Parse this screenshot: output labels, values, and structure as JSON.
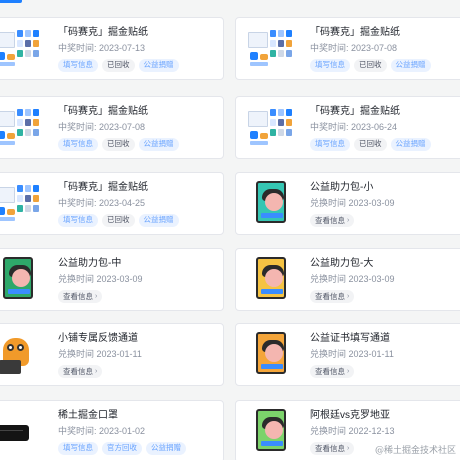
{
  "tab": {
    "active_indicator_color": "#1e80ff"
  },
  "cards": [
    {
      "title": "「码赛克」掘金贴纸",
      "time": "中奖时间: 2023-07-13",
      "thumb": "stickers",
      "buttons": [
        {
          "label": "填写信息",
          "style": "blue"
        },
        {
          "label": "已回收",
          "style": "gray"
        },
        {
          "label": "公益捐赠",
          "style": "blue"
        }
      ]
    },
    {
      "title": "「码赛克」掘金贴纸",
      "time": "中奖时间: 2023-07-08",
      "thumb": "stickers",
      "buttons": [
        {
          "label": "填写信息",
          "style": "blue"
        },
        {
          "label": "已回收",
          "style": "gray"
        },
        {
          "label": "公益捐赠",
          "style": "blue"
        }
      ]
    },
    {
      "title": "「码赛克」掘金贴纸",
      "time": "中奖时间: 2023-07-08",
      "thumb": "stickers",
      "buttons": [
        {
          "label": "填写信息",
          "style": "blue"
        },
        {
          "label": "已回收",
          "style": "gray"
        },
        {
          "label": "公益捐赠",
          "style": "blue"
        }
      ]
    },
    {
      "title": "「码赛克」掘金贴纸",
      "time": "中奖时间: 2023-06-24",
      "thumb": "stickers",
      "buttons": [
        {
          "label": "填写信息",
          "style": "blue"
        },
        {
          "label": "已回收",
          "style": "gray"
        },
        {
          "label": "公益捐赠",
          "style": "blue"
        }
      ]
    },
    {
      "title": "「码赛克」掘金贴纸",
      "time": "中奖时间: 2023-04-25",
      "thumb": "stickers",
      "buttons": [
        {
          "label": "填写信息",
          "style": "blue"
        },
        {
          "label": "已回收",
          "style": "gray"
        },
        {
          "label": "公益捐赠",
          "style": "blue"
        }
      ]
    },
    {
      "title": "公益助力包-小",
      "time": "兑换时间 2023-03-09",
      "thumb": "pack-teal",
      "buttons": [
        {
          "label": "查看信息",
          "style": "view"
        }
      ]
    },
    {
      "title": "公益助力包-中",
      "time": "兑换时间 2023-03-09",
      "thumb": "pack-green",
      "buttons": [
        {
          "label": "查看信息",
          "style": "view"
        }
      ]
    },
    {
      "title": "公益助力包-大",
      "time": "兑换时间 2023-03-09",
      "thumb": "pack-yellow",
      "buttons": [
        {
          "label": "查看信息",
          "style": "view"
        }
      ]
    },
    {
      "title": "小铺专属反馈通道",
      "time": "兑换时间 2023-01-11",
      "thumb": "mascot",
      "buttons": [
        {
          "label": "查看信息",
          "style": "view"
        }
      ]
    },
    {
      "title": "公益证书填写通道",
      "time": "兑换时间 2023-01-11",
      "thumb": "pack-orange",
      "buttons": [
        {
          "label": "查看信息",
          "style": "view"
        }
      ]
    },
    {
      "title": "稀土掘金口罩",
      "time": "中奖时间: 2023-01-02",
      "thumb": "mask",
      "buttons": [
        {
          "label": "填写信息",
          "style": "blue"
        },
        {
          "label": "官方回收",
          "style": "blue"
        },
        {
          "label": "公益捐赠",
          "style": "blue"
        }
      ]
    },
    {
      "title": "阿根廷vs克罗地亚",
      "time": "兑换时间 2022-12-13",
      "thumb": "card-green",
      "buttons": [
        {
          "label": "查看信息",
          "style": "view"
        }
      ]
    }
  ],
  "watermark": "@稀土掘金技术社区"
}
